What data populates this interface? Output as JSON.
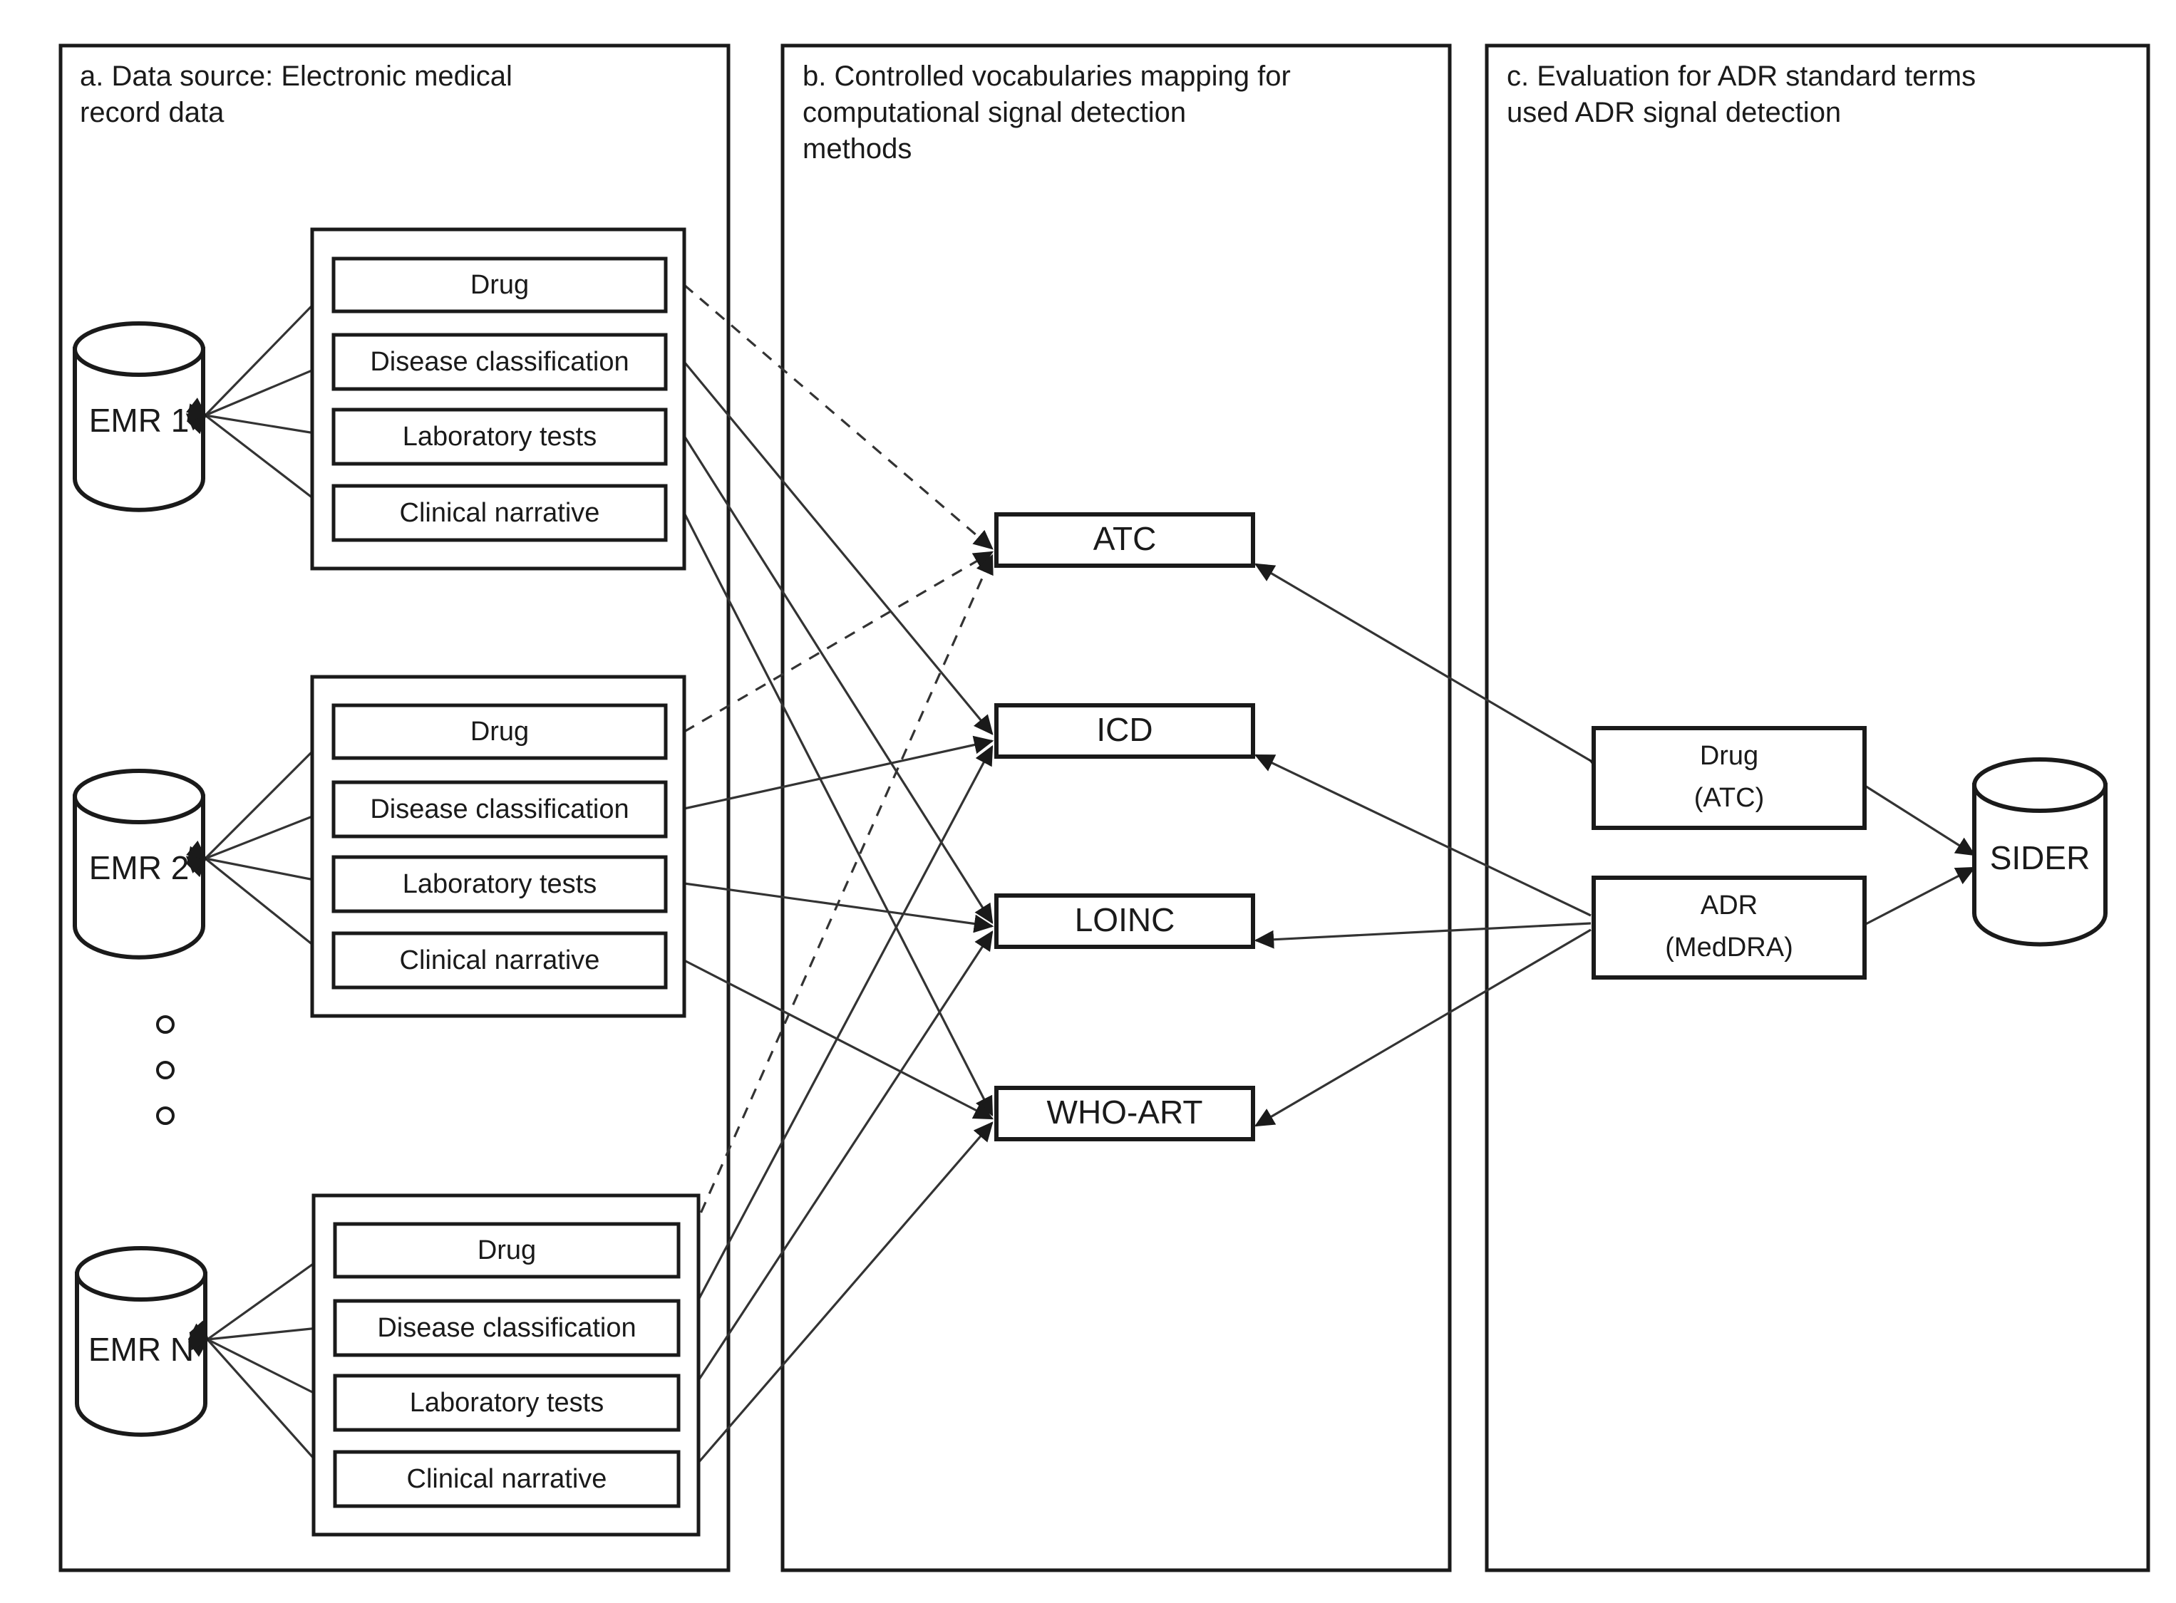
{
  "figure": {
    "panels": [
      {
        "id": "a",
        "title": "a. Data source: Electronic medical\nrecord data"
      },
      {
        "id": "b",
        "title": "b. Controlled vocabularies mapping for\ncomputational signal detection\nmethods"
      },
      {
        "id": "c",
        "title": "c. Evaluation for ADR standard terms\nused ADR signal detection"
      }
    ]
  },
  "panel_a": {
    "title_line1": "a. Data source: Electronic medical",
    "title_line2": "record data",
    "sources": [
      {
        "db_label": "EMR 1",
        "items": [
          "Drug",
          "Disease classification",
          "Laboratory tests",
          "Clinical narrative"
        ]
      },
      {
        "db_label": "EMR 2",
        "items": [
          "Drug",
          "Disease classification",
          "Laboratory tests",
          "Clinical narrative"
        ]
      },
      {
        "db_label": "EMR N",
        "items": [
          "Drug",
          "Disease classification",
          "Laboratory tests",
          "Clinical narrative"
        ]
      }
    ],
    "ellipsis": "vertical-three-dots"
  },
  "panel_b": {
    "title_line1": "b. Controlled vocabularies mapping for",
    "title_line2": "computational signal detection",
    "title_line3": "methods",
    "vocabularies": [
      "ATC",
      "ICD",
      "LOINC",
      "WHO-ART"
    ]
  },
  "panel_c": {
    "title_line1": "c. Evaluation for ADR standard terms",
    "title_line2": "used ADR signal detection",
    "terms": [
      {
        "line1": "Drug",
        "line2": "(ATC)"
      },
      {
        "line1": "ADR",
        "line2": "(MedDRA)"
      }
    ],
    "reference_db": "SIDER"
  },
  "colors": {
    "stroke": "#1a1a1a",
    "edge": "#333333",
    "background": "#ffffff"
  }
}
